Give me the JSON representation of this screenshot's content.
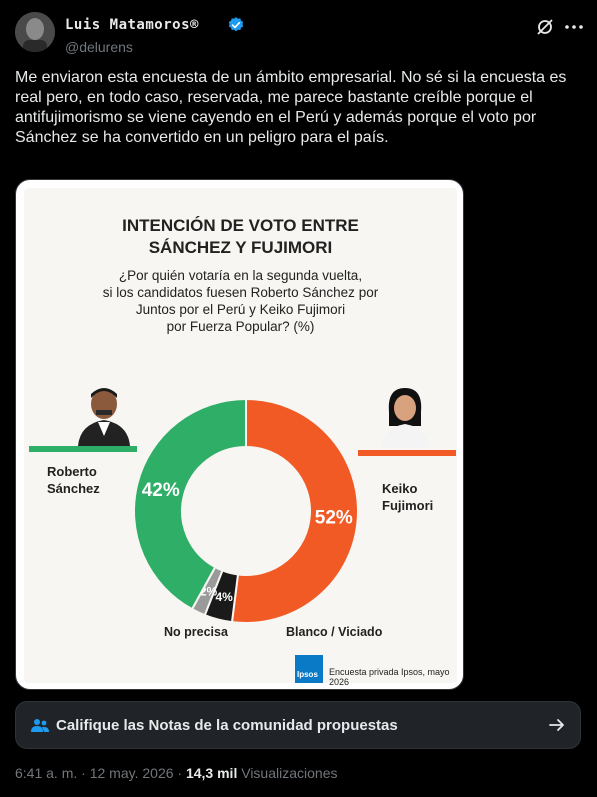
{
  "author": {
    "name": "Luis Matamoros®",
    "handle": "@delurens",
    "verified": true
  },
  "tweet": {
    "text": "Me enviaron esta encuesta de un ámbito empresarial. No sé si la encuesta es real pero, en todo caso, reservada, me parece bastante creíble porque el antifujimorismo se viene cayendo en el Perú y además porque el voto por Sánchez se ha convertido en un peligro para el país."
  },
  "poll_image": {
    "title_line1": "INTENCIÓN DE VOTO ENTRE",
    "title_line2": "SÁNCHEZ Y FUJIMORI",
    "subtitle_line1": "¿Por quién votaría en la segunda vuelta,",
    "subtitle_line2": "si los candidatos fuesen Roberto Sánchez por",
    "subtitle_line3": "Juntos por el Perú y Keiko Fujimori",
    "subtitle_line4": "por Fuerza Popular? (%)",
    "left_name_line1": "Roberto",
    "left_name_line2": "Sánchez",
    "right_name_line1": "Keiko",
    "right_name_line2": "Fujimori",
    "label_no_precisa": "No precisa",
    "label_blanco": "Blanco / Viciado",
    "logo_text": "Ipsos",
    "source": "Encuesta privada Ipsos, mayo 2026",
    "colors": {
      "sanchez": "#2eae67",
      "fujimori": "#f15a24",
      "blanco": "#1a1a1a",
      "no_precisa": "#9a9a9a"
    }
  },
  "chart_data": {
    "type": "pie",
    "categories": [
      "Keiko Fujimori",
      "Blanco / Viciado",
      "No precisa",
      "Roberto Sánchez"
    ],
    "values": [
      52,
      4,
      2,
      42
    ],
    "value_labels": [
      "52%",
      "4%",
      "2%",
      "42%"
    ],
    "title": "INTENCIÓN DE VOTO ENTRE SÁNCHEZ Y FUJIMORI",
    "style": "donut"
  },
  "community_notes": {
    "label": "Califique las Notas de la comunidad propuestas"
  },
  "meta": {
    "time": "6:41 a. m.",
    "separator": "·",
    "date": "12 may. 2026",
    "views_count": "14,3 mil",
    "views_label": "Visualizaciones"
  },
  "icons": {
    "grok": "grok-icon",
    "more": "more-icon",
    "notes": "community-notes-icon",
    "arrow": "arrow-right-icon"
  }
}
